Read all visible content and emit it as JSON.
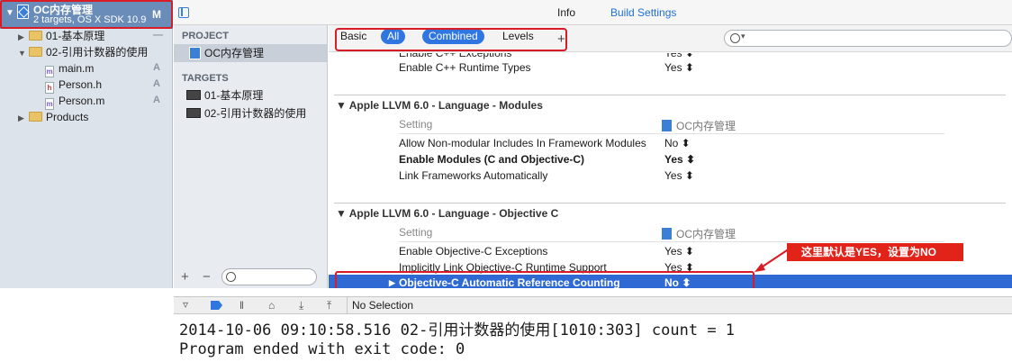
{
  "navigator": {
    "project_name": "OC内存管理",
    "project_subtitle": "2 targets, OS X SDK 10.9",
    "project_status": "M",
    "items": [
      {
        "label": "01-基本原理",
        "status": "—"
      },
      {
        "label": "02-引用计数器的使用",
        "status": ""
      },
      {
        "label": "main.m",
        "status": "A"
      },
      {
        "label": "Person.h",
        "status": "A"
      },
      {
        "label": "Person.m",
        "status": "A"
      },
      {
        "label": "Products",
        "status": ""
      }
    ]
  },
  "targets_list": {
    "project_header": "PROJECT",
    "project_item": "OC内存管理",
    "targets_header": "TARGETS",
    "targets": [
      "01-基本原理",
      "02-引用计数器的使用"
    ],
    "add": "+",
    "remove": "−"
  },
  "tabs": {
    "info": "Info",
    "build_settings": "Build Settings"
  },
  "filter": {
    "basic": "Basic",
    "all": "All",
    "combined": "Combined",
    "levels": "Levels",
    "add": "+"
  },
  "settings": {
    "top_rows": [
      {
        "name": "Enable C++ Exceptions",
        "value": "Yes ⬍"
      },
      {
        "name": "Enable C++ Runtime Types",
        "value": "Yes ⬍"
      }
    ],
    "sections": [
      {
        "title": "Apple LLVM 6.0 - Language - Modules",
        "setting_header": "Setting",
        "project_header": "OC内存管理",
        "rows": [
          {
            "name": "Allow Non-modular Includes In Framework Modules",
            "value": "No ⬍"
          },
          {
            "name": "Enable Modules (C and Objective-C)",
            "value": "Yes ⬍"
          },
          {
            "name": "Link Frameworks Automatically",
            "value": "Yes ⬍"
          }
        ]
      },
      {
        "title": "Apple LLVM 6.0 - Language - Objective C",
        "setting_header": "Setting",
        "project_header": "OC内存管理",
        "rows": [
          {
            "name": "Enable Objective-C Exceptions",
            "value": "Yes ⬍"
          },
          {
            "name": "Implicitly Link Objective-C Runtime Support",
            "value": "Yes ⬍"
          },
          {
            "name": "Objective-C Automatic Reference Counting",
            "value": "No ⬍"
          }
        ]
      }
    ]
  },
  "debug": {
    "no_selection": "No Selection"
  },
  "console": {
    "line1": "2014-10-06 09:10:58.516 02-引用计数器的使用[1010:303] count = 1",
    "line2": "Program ended with exit code: 0"
  },
  "annotation": {
    "callout": "这里默认是YES，设置为NO"
  },
  "colors": {
    "accent": "#2f76e0",
    "annotation_red": "#d81b24",
    "selection_blue": "#2f6ad4"
  }
}
